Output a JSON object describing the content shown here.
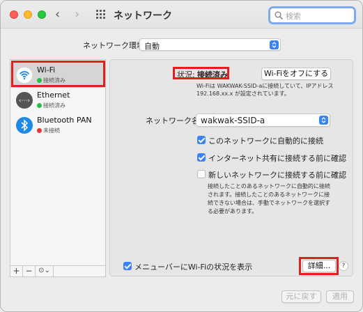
{
  "window": {
    "title": "ネットワーク"
  },
  "search": {
    "placeholder": "検索"
  },
  "location": {
    "label": "ネットワーク環境:",
    "value": "自動"
  },
  "services": [
    {
      "name": "Wi-Fi",
      "status": "接続済み",
      "status_color": "#2dbb4a",
      "icon": "wifi-icon"
    },
    {
      "name": "Ethernet",
      "status": "接続済み",
      "status_color": "#2dbb4a",
      "icon": "ethernet-icon"
    },
    {
      "name": "Bluetooth PAN",
      "status": "未接続",
      "status_color": "#e53935",
      "icon": "bluetooth-icon"
    }
  ],
  "pane_toolbar": {
    "add": "+",
    "remove": "−",
    "action": "⊙⌄"
  },
  "detail": {
    "status_label": "状況:",
    "status_value": "接続済み",
    "wifi_off_button": "Wi-Fiをオフにする",
    "status_desc": "Wi-Fiは WAKWAK-SSID-aに接続していて、IPアドレス192.168.xx.x が設定されています。",
    "network_name_label": "ネットワーク名:",
    "network_name_value": "wakwak-SSID-a",
    "checkboxes": [
      {
        "label": "このネットワークに自動的に接続",
        "checked": true
      },
      {
        "label": "インターネット共有に接続する前に確認",
        "checked": true
      },
      {
        "label": "新しいネットワークに接続する前に確認",
        "checked": false
      }
    ],
    "ask_desc": "接続したことのあるネットワークに自動的に接続されます。接続したことのあるネットワークに接続できない場合は、手動でネットワークを選択する必要があります。",
    "menubar_checkbox_label": "メニューバーにWi-Fiの状況を表示",
    "details_button": "詳細...",
    "help": "?"
  },
  "footer": {
    "revert": "元に戻す",
    "apply": "適用"
  },
  "colors": {
    "accent": "#3b82f6",
    "highlight": "#e02020"
  }
}
